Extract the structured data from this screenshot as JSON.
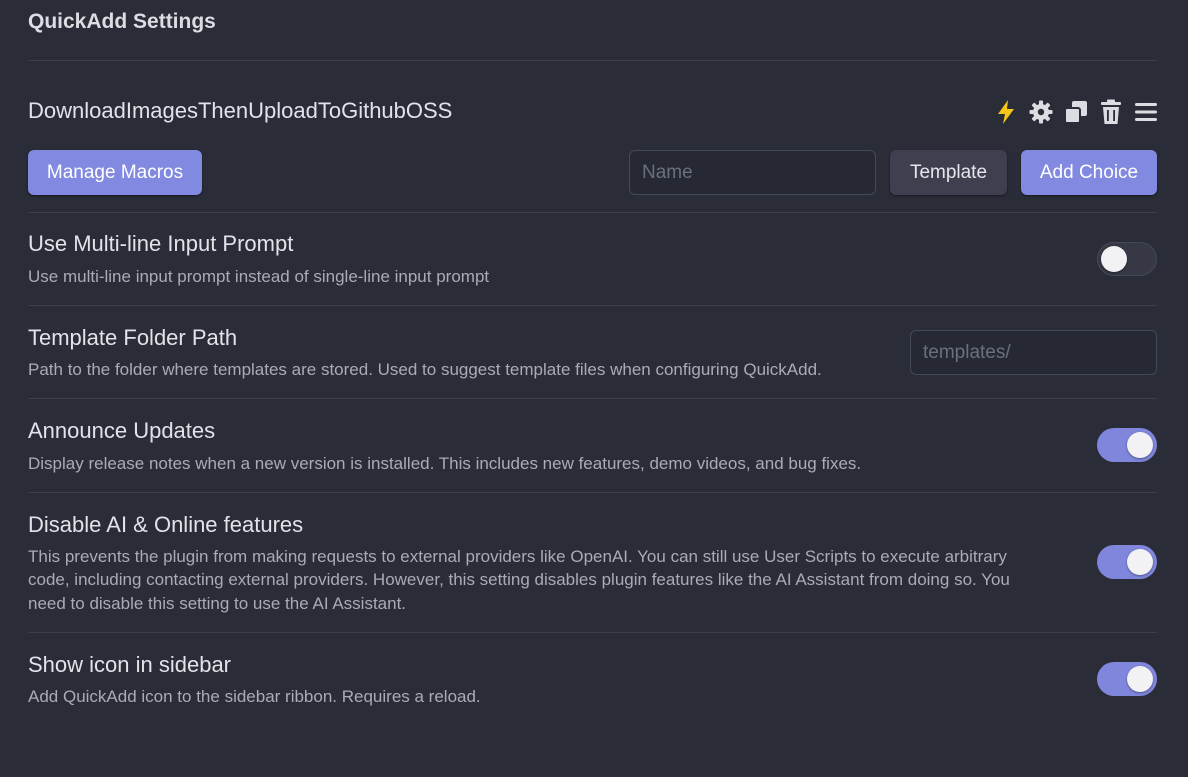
{
  "header": {
    "title": "QuickAdd Settings"
  },
  "choice": {
    "name": "DownloadImagesThenUploadToGithubOSS",
    "icons": [
      "lightning-icon",
      "gear-icon",
      "duplicate-icon",
      "trash-icon",
      "menu-icon"
    ],
    "lightning_color": "#f5c518"
  },
  "toolbar": {
    "manage_macros_label": "Manage Macros",
    "name_placeholder": "Name",
    "template_label": "Template",
    "add_choice_label": "Add Choice"
  },
  "settings": [
    {
      "title": "Use Multi-line Input Prompt",
      "desc": "Use multi-line input prompt instead of single-line input prompt",
      "enabled": false
    },
    {
      "title": "Template Folder Path",
      "desc": "Path to the folder where templates are stored. Used to suggest template files when configuring QuickAdd.",
      "placeholder": "templates/"
    },
    {
      "title": "Announce Updates",
      "desc": "Display release notes when a new version is installed. This includes new features, demo videos, and bug fixes.",
      "enabled": true
    },
    {
      "title": "Disable AI & Online features",
      "desc_lines": [
        "This prevents the plugin from making requests to external providers like OpenAI. You can still use User Scripts to execute arbitrary",
        "code, including contacting external providers. However, this setting disables plugin features like the AI Assistant from doing so. You",
        "need to disable this setting to use the AI Assistant."
      ],
      "enabled": true
    },
    {
      "title": "Show icon in sidebar",
      "desc": "Add QuickAdd icon to the sidebar ribbon. Requires a reload.",
      "enabled": true
    }
  ],
  "colors": {
    "background": "#2a2c38",
    "accent": "#8189e0",
    "divider": "#3c3e4b"
  }
}
